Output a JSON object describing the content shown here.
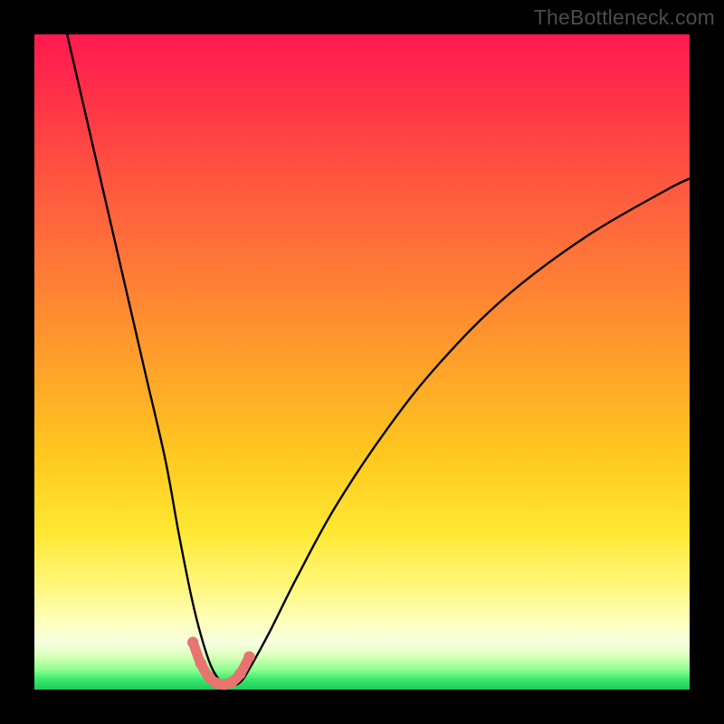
{
  "watermark": "TheBottleneck.com",
  "colors": {
    "frame": "#000000",
    "curve_stroke": "#000000",
    "emphasis_stroke": "#e8736f",
    "gradient_top": "#ff1a50",
    "gradient_bottom": "#1fc95c"
  },
  "chart_data": {
    "type": "line",
    "title": "",
    "xlabel": "",
    "ylabel": "",
    "xlim": [
      0,
      100
    ],
    "ylim": [
      0,
      100
    ],
    "grid": false,
    "legend": false,
    "series": [
      {
        "name": "bottleneck-curve",
        "x": [
          5,
          8,
          11,
          14,
          17,
          20,
          22,
          24,
          25.5,
          27,
          28.5,
          30,
          31.5,
          33,
          36,
          40,
          46,
          54,
          62,
          72,
          84,
          96,
          100
        ],
        "values": [
          100,
          87,
          74,
          61,
          48,
          35,
          24,
          14,
          8,
          3.5,
          1.2,
          0.6,
          1.2,
          3.5,
          9,
          17,
          28,
          40,
          50,
          60,
          69,
          76,
          78
        ]
      },
      {
        "name": "emphasis-valley",
        "x": [
          24.2,
          25.4,
          26.6,
          27.8,
          29.0,
          30.2,
          31.4,
          32.8
        ],
        "values": [
          7.2,
          4.0,
          2.0,
          1.0,
          0.8,
          1.2,
          2.4,
          5.0
        ]
      }
    ],
    "annotations": []
  }
}
